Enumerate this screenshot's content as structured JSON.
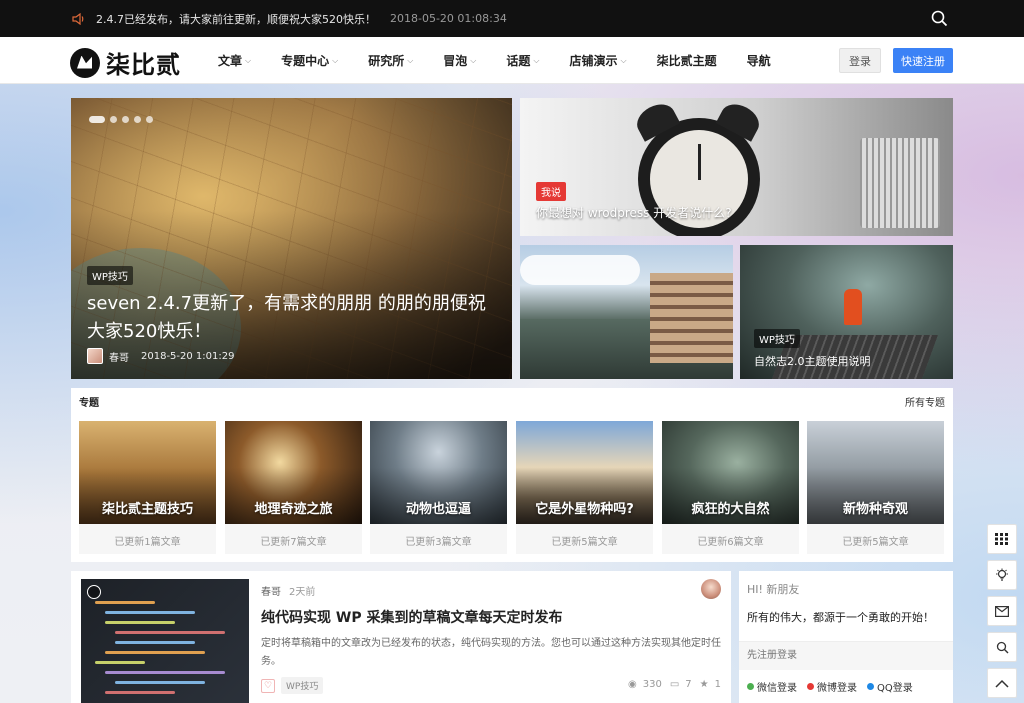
{
  "topbar": {
    "notice": "2.4.7已经发布，请大家前往更新，顺便祝大家520快乐！",
    "time": "2018-05-20 01:08:34"
  },
  "header": {
    "logo_text": "柒比贰",
    "nav": [
      {
        "label": "文章",
        "dropdown": true
      },
      {
        "label": "专题中心",
        "dropdown": true
      },
      {
        "label": "研究所",
        "dropdown": true
      },
      {
        "label": "冒泡",
        "dropdown": true
      },
      {
        "label": "话题",
        "dropdown": true
      },
      {
        "label": "店铺演示",
        "dropdown": true
      },
      {
        "label": "柒比贰主题",
        "dropdown": false
      },
      {
        "label": "导航",
        "dropdown": false
      }
    ],
    "login_label": "登录",
    "register_label": "快速注册"
  },
  "hero": {
    "main": {
      "tag": "WP技巧",
      "title": "seven 2.4.7更新了，有需求的朋朋 的朋的朋便祝大家520快乐！",
      "author": "春哥",
      "date": "2018-5-20 1:01:29"
    },
    "top_right": {
      "tag": "我说",
      "title": "你最想对 wrodpress 开发者说什么?"
    },
    "bottom_right": {
      "tag": "WP技巧",
      "title": "自然志2.0主题使用说明"
    }
  },
  "topics": {
    "heading": "专题",
    "all_label": "所有专题",
    "items": [
      {
        "name": "柒比贰主题技巧",
        "count": "已更新1篇文章"
      },
      {
        "name": "地理奇迹之旅",
        "count": "已更新7篇文章"
      },
      {
        "name": "动物也逗逼",
        "count": "已更新3篇文章"
      },
      {
        "name": "它是外星物种吗?",
        "count": "已更新5篇文章"
      },
      {
        "name": "疯狂的大自然",
        "count": "已更新6篇文章"
      },
      {
        "name": "新物种奇观",
        "count": "已更新5篇文章"
      }
    ]
  },
  "post": {
    "author": "春哥",
    "time": "2天前",
    "title": "纯代码实现 WP 采集到的草稿文章每天定时发布",
    "excerpt": "定时将草稿箱中的文章改为已经发布的状态，纯代码实现的方法。您也可以通过这种方法实现其他定时任务。",
    "tag": "WP技巧",
    "views": "330",
    "comments": "7",
    "likes": "1"
  },
  "welcome": {
    "hi": "HI! 新朋友",
    "motto": "所有的伟大，都源于一个勇敢的开始！",
    "register_prompt": "先注册登录",
    "logins": [
      {
        "label": "微信登录",
        "color": "#4caf50"
      },
      {
        "label": "微博登录",
        "color": "#e53935"
      },
      {
        "label": "QQ登录",
        "color": "#1e88e5"
      }
    ]
  },
  "colors": {
    "accent": "#3b82f6",
    "topbar_bg": "#111111",
    "tag_red": "#e53935"
  },
  "tools": [
    "grid-icon",
    "bulb-icon",
    "mail-icon",
    "search-icon",
    "arrow-up-icon"
  ]
}
